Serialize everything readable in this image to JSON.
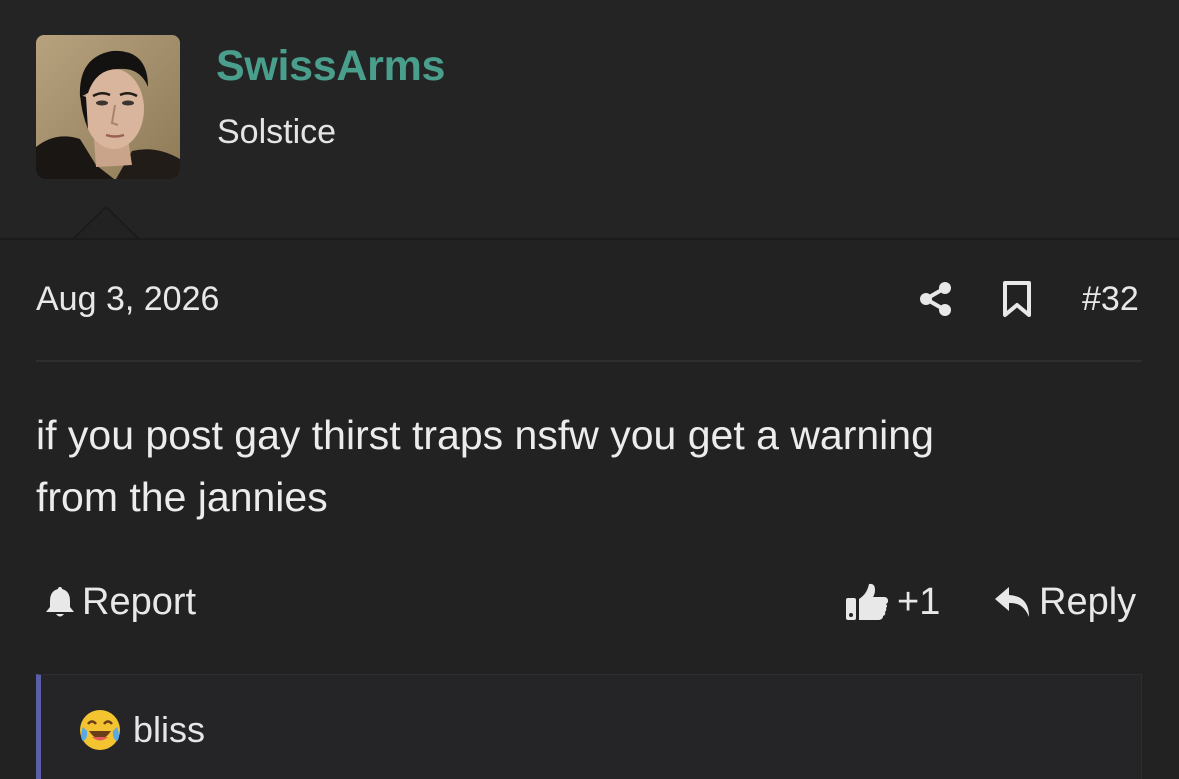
{
  "post": {
    "author": "SwissArms",
    "user_title": "Solstice",
    "date": "Aug 3, 2026",
    "number": "#32",
    "message_line1": "if you post gay thirst traps nsfw you get a warning",
    "message_line2": "from the jannies",
    "icons": {
      "share": "share-icon",
      "bookmark": "bookmark-icon",
      "report": "bell-icon",
      "like": "thumbs-up-icon",
      "reply": "reply-arrow-icon",
      "reaction": "joy-emoji-icon"
    }
  },
  "actions": {
    "report_label": "Report",
    "like_count": "+1",
    "reply_label": "Reply"
  },
  "reactions": {
    "label": "bliss"
  },
  "colors": {
    "background": "#222223",
    "username": "#4a9e8c",
    "text": "#e8e8e8",
    "quote_bar": "#5b5fa8"
  }
}
